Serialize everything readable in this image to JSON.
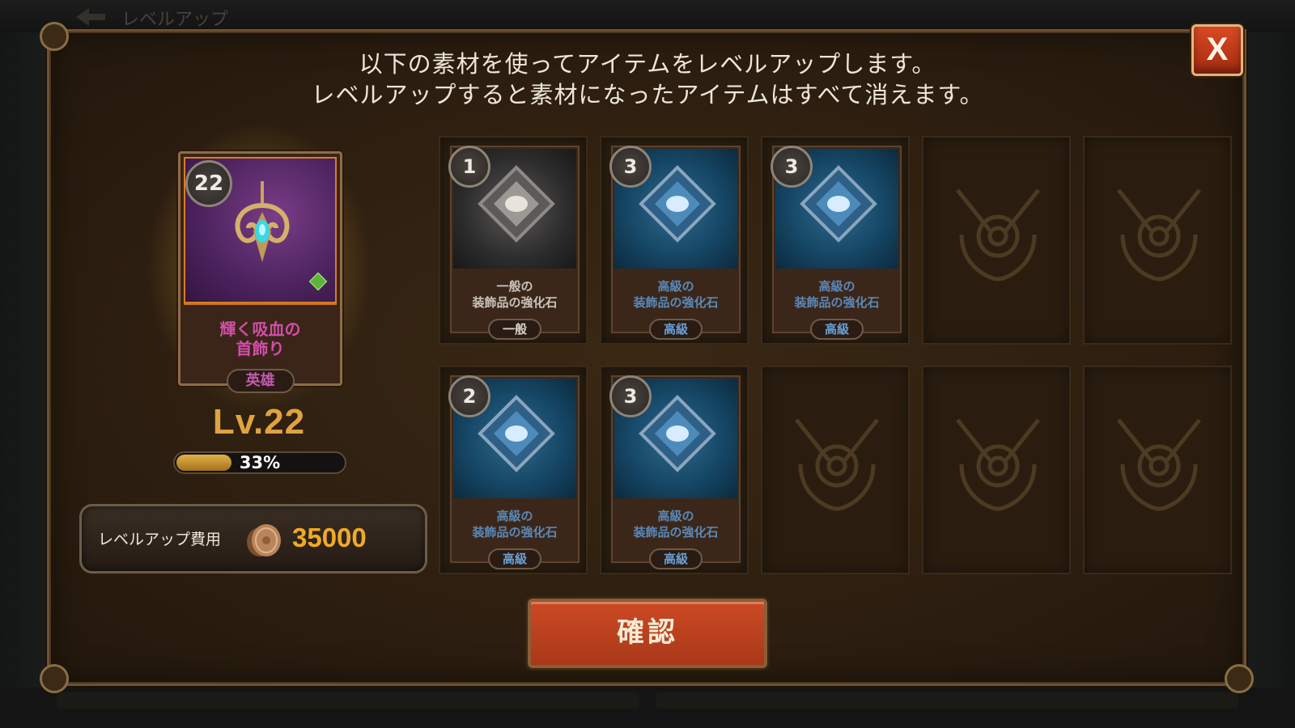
{
  "background": {
    "title": "レベルアップ"
  },
  "header": {
    "line1": "以下の素材を使ってアイテムをレベルアップします。",
    "line2": "レベルアップすると素材になったアイテムはすべて消えます。"
  },
  "close_button": {
    "label": "X",
    "icon": "close-icon"
  },
  "hero_item": {
    "level_badge": "22",
    "name_line1": "輝く吸血の",
    "name_line2": "首飾り",
    "rarity": "英雄",
    "rarity_color": "#c25aaf",
    "level_text": "Lv.22",
    "progress_percent": 33,
    "progress_text": "33%"
  },
  "cost": {
    "label": "レベルアップ費用",
    "value": "35000",
    "icon": "coin-icon"
  },
  "materials": [
    {
      "count": "1",
      "name_line1": "一般の",
      "name_line2": "装飾品の強化石",
      "rarity": "一般",
      "tier": "common"
    },
    {
      "count": "3",
      "name_line1": "高級の",
      "name_line2": "装飾品の強化石",
      "rarity": "高級",
      "tier": "high"
    },
    {
      "count": "3",
      "name_line1": "高級の",
      "name_line2": "装飾品の強化石",
      "rarity": "高級",
      "tier": "high"
    },
    {
      "count": "2",
      "name_line1": "高級の",
      "name_line2": "装飾品の強化石",
      "rarity": "高級",
      "tier": "high"
    },
    {
      "count": "3",
      "name_line1": "高級の",
      "name_line2": "装飾品の強化石",
      "rarity": "高級",
      "tier": "high"
    }
  ],
  "empty_slot_icon": "emblem-icon",
  "confirm_button": {
    "label": "確認"
  },
  "colors": {
    "accent_gold": "#e0a340",
    "confirm_red": "#cc4a24",
    "high_blue": "#5b88b7"
  }
}
